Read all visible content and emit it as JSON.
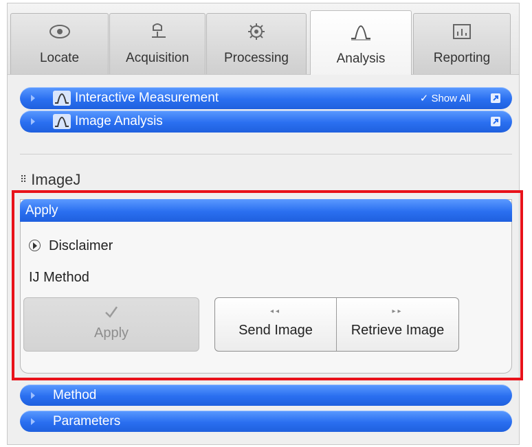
{
  "tabs": [
    {
      "label": "Locate",
      "icon": "eye-icon",
      "active": false
    },
    {
      "label": "Acquisition",
      "icon": "microscope-icon",
      "active": false
    },
    {
      "label": "Processing",
      "icon": "gear-icon",
      "active": false
    },
    {
      "label": "Analysis",
      "icon": "analysis-peak-icon",
      "active": true
    },
    {
      "label": "Reporting",
      "icon": "report-chart-icon",
      "active": false
    }
  ],
  "tool_groups": [
    {
      "label": "Interactive Measurement",
      "show_all": "Show All"
    },
    {
      "label": "Image Analysis"
    }
  ],
  "section_title": "ImageJ",
  "apply_panel": {
    "header": "Apply",
    "disclaimer": "Disclaimer",
    "method_label": "IJ Method",
    "apply_button": "Apply",
    "send_button": "Send Image",
    "retrieve_button": "Retrieve Image"
  },
  "collapsed_sections": [
    "Method",
    "Parameters"
  ],
  "colors": {
    "accent_blue": "#2a6ff0",
    "highlight_red": "#e8121a"
  }
}
